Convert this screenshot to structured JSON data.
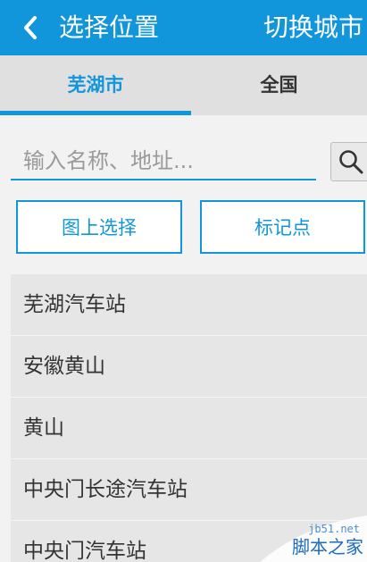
{
  "header": {
    "title": "选择位置",
    "switch_city": "切换城市"
  },
  "tabs": [
    {
      "label": "芜湖市",
      "active": true
    },
    {
      "label": "全国",
      "active": false
    }
  ],
  "search": {
    "placeholder": "输入名称、地址...",
    "value": ""
  },
  "actions": {
    "map_select": "图上选择",
    "mark_point": "标记点"
  },
  "results": [
    "芜湖汽车站",
    "安徽黄山",
    "黄山",
    "中央门长途汽车站",
    "中央门汽车站"
  ],
  "watermark": {
    "url": "jb51.net",
    "text": "脚本之家"
  },
  "colors": {
    "primary": "#1296db",
    "tab_bg": "#e0e0e0",
    "list_bg": "#e6e6e6"
  }
}
